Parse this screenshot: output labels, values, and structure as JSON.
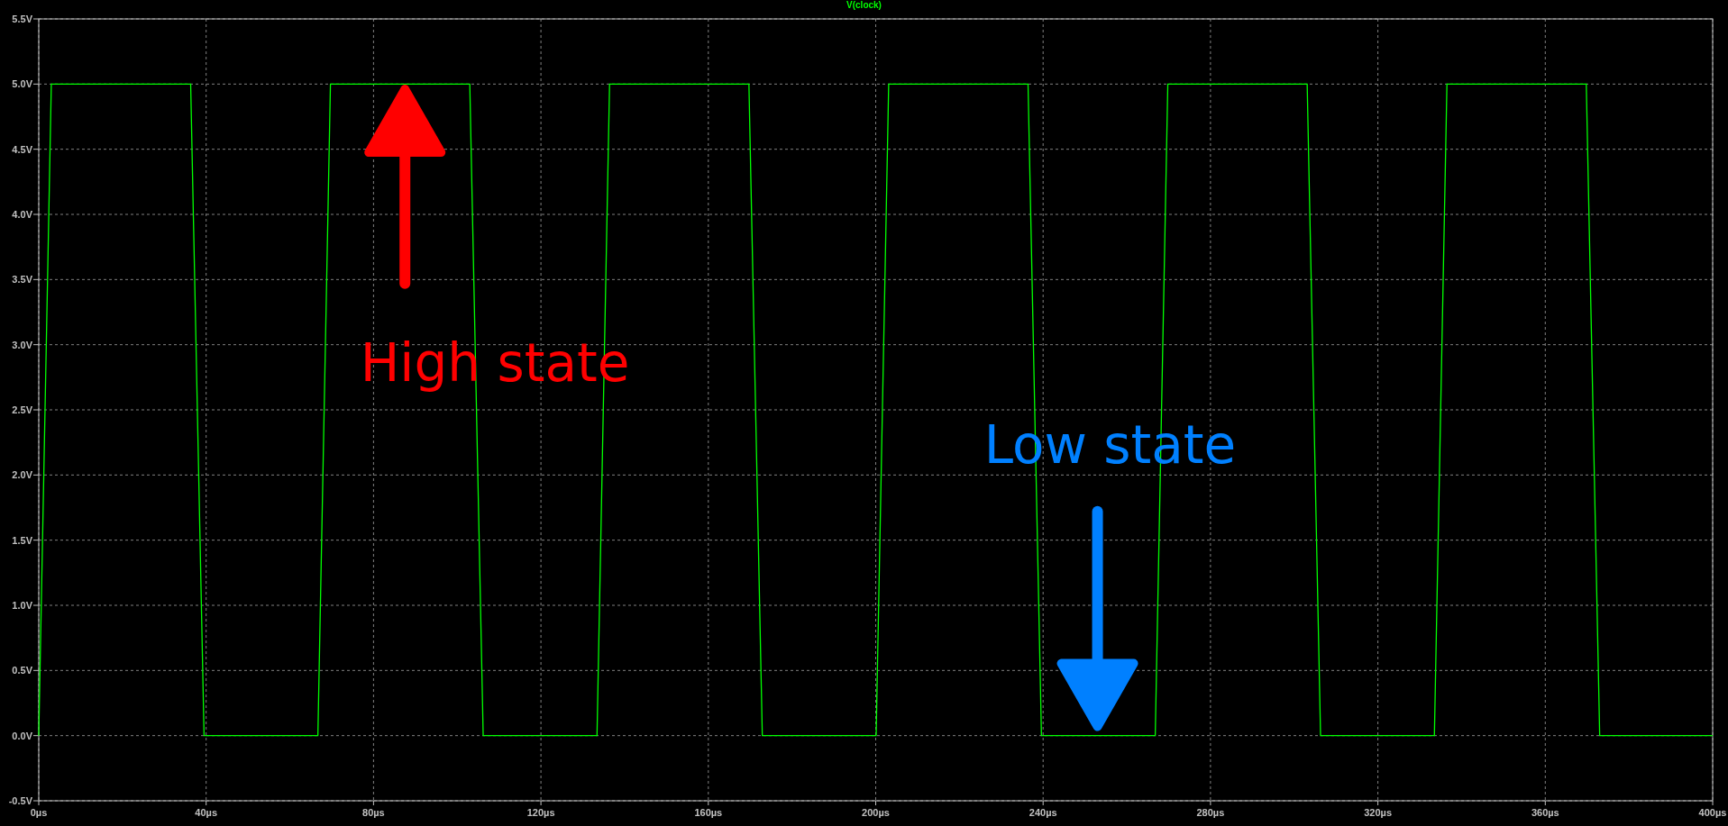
{
  "chart_data": {
    "type": "line",
    "grid": true,
    "xlim": [
      0,
      400
    ],
    "ylim": [
      -0.5,
      5.5
    ],
    "xticks": [
      {
        "value": 0,
        "label": "0µs"
      },
      {
        "value": 40,
        "label": "40µs"
      },
      {
        "value": 80,
        "label": "80µs"
      },
      {
        "value": 120,
        "label": "120µs"
      },
      {
        "value": 160,
        "label": "160µs"
      },
      {
        "value": 200,
        "label": "200µs"
      },
      {
        "value": 240,
        "label": "240µs"
      },
      {
        "value": 280,
        "label": "280µs"
      },
      {
        "value": 320,
        "label": "320µs"
      },
      {
        "value": 360,
        "label": "360µs"
      },
      {
        "value": 400,
        "label": "400µs"
      }
    ],
    "yticks": [
      {
        "value": 5.5,
        "label": "5.5V"
      },
      {
        "value": 5.0,
        "label": "5.0V"
      },
      {
        "value": 4.5,
        "label": "4.5V"
      },
      {
        "value": 4.0,
        "label": "4.0V"
      },
      {
        "value": 3.5,
        "label": "3.5V"
      },
      {
        "value": 3.0,
        "label": "3.0V"
      },
      {
        "value": 2.5,
        "label": "2.5V"
      },
      {
        "value": 2.0,
        "label": "2.0V"
      },
      {
        "value": 1.5,
        "label": "1.5V"
      },
      {
        "value": 1.0,
        "label": "1.0V"
      },
      {
        "value": 0.5,
        "label": "0.5V"
      },
      {
        "value": 0.0,
        "label": "0.0V"
      },
      {
        "value": -0.5,
        "label": "-0.5V"
      }
    ],
    "x": [
      0,
      3,
      36.3,
      39.5,
      66.7,
      69.7,
      103,
      106.2,
      133.4,
      136.4,
      169.7,
      172.9,
      200.1,
      203.1,
      236.4,
      239.6,
      266.8,
      269.8,
      303.1,
      306.3,
      333.5,
      336.5,
      369.8,
      373,
      400
    ],
    "series": [
      {
        "name": "V(clock)",
        "color": "#00ff00",
        "values": [
          0,
          5,
          5,
          0,
          0,
          5,
          5,
          0,
          0,
          5,
          5,
          0,
          0,
          5,
          5,
          0,
          0,
          5,
          5,
          0,
          0,
          5,
          5,
          0,
          0
        ]
      }
    ]
  },
  "callouts": [
    {
      "text": "High state",
      "color": "#ff0000",
      "kind": "up"
    },
    {
      "text": "Low state",
      "color": "#0080ff",
      "kind": "down"
    }
  ]
}
